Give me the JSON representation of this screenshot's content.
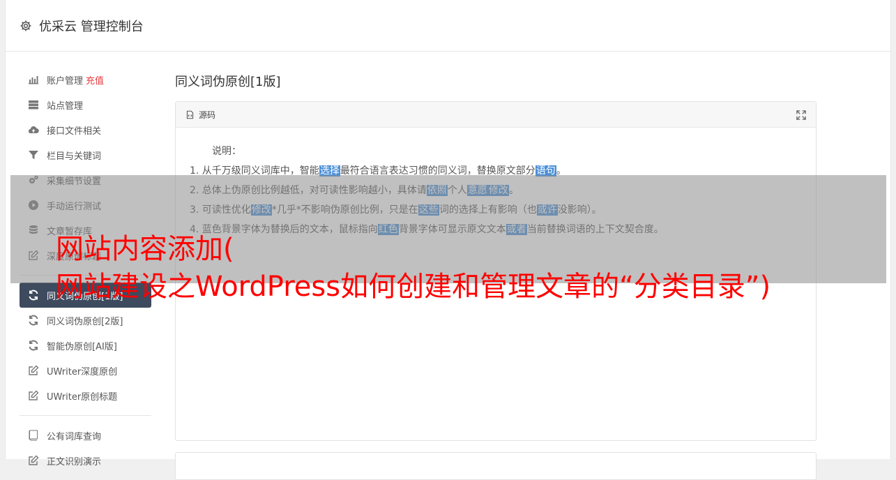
{
  "header": {
    "title": "优采云 管理控制台",
    "icon": "gear-icon"
  },
  "sidebar": {
    "items": [
      {
        "label": "账户管理",
        "badge": "充值",
        "icon": "bar-chart-icon"
      },
      {
        "label": "站点管理",
        "icon": "server-icon"
      },
      {
        "label": "接口文件相关",
        "icon": "cloud-upload-icon"
      },
      {
        "label": "栏目与关键词",
        "icon": "filter-icon"
      },
      {
        "label": "采集细节设置",
        "icon": "cogs-icon"
      },
      {
        "label": "手动运行测试",
        "icon": "play-circle-icon"
      },
      {
        "label": "文章暂存库",
        "icon": "database-icon"
      },
      {
        "label": "深度原创标题",
        "icon": "edit-icon"
      },
      {
        "label": "同义词伪原创[1版]",
        "icon": "refresh-icon",
        "active": true
      },
      {
        "label": "同义词伪原创[2版]",
        "icon": "refresh-icon"
      },
      {
        "label": "智能伪原创[AI版]",
        "icon": "refresh-icon"
      },
      {
        "label": "UWriter深度原创",
        "icon": "edit-icon"
      },
      {
        "label": "UWriter原创标题",
        "icon": "edit-icon"
      },
      {
        "label": "公有词库查询",
        "icon": "book-icon"
      },
      {
        "label": "正文识别演示",
        "icon": "edit-icon"
      }
    ]
  },
  "main": {
    "page_title": "同义词伪原创[1版]",
    "panel": {
      "label": "源码",
      "desc_label": "说明：",
      "lines": [
        [
          "1. 从千万级同义词库中，智能",
          {
            "hl": "选择"
          },
          "最符合语言表达习惯的同义词，替换原文部分",
          {
            "hl": "语句"
          },
          "。"
        ],
        [
          "2. 总体上伪原创比例越低，对可读性影响越小，具体请",
          {
            "hl": "依照"
          },
          "个人",
          {
            "hl": "意愿"
          },
          {
            "hl": "修改"
          },
          "。"
        ],
        [
          "3. 可读性优化",
          {
            "hl": "修改"
          },
          "*几乎*不影响伪原创比例，只是在",
          {
            "hl": "这些"
          },
          "词的选择上有影响（也",
          {
            "hl": "或许"
          },
          "没影响）。"
        ],
        [
          "4. 蓝色背景字体为替换后的文本，鼠标指向",
          {
            "hl": "红色"
          },
          "背景字体可显示原文文本",
          {
            "hl": "或者"
          },
          "当前替换词语的上下文契合度。"
        ]
      ]
    }
  },
  "watermark": {
    "line1": "网站内容添加(",
    "line2": "网站建设之WordPress如何创建和管理文章的“分类目录”)"
  },
  "colors": {
    "active_bg": "#3e4a5e",
    "highlight": "#4a90d9",
    "watermark": "#ff0000",
    "recharge": "#e4393c"
  }
}
